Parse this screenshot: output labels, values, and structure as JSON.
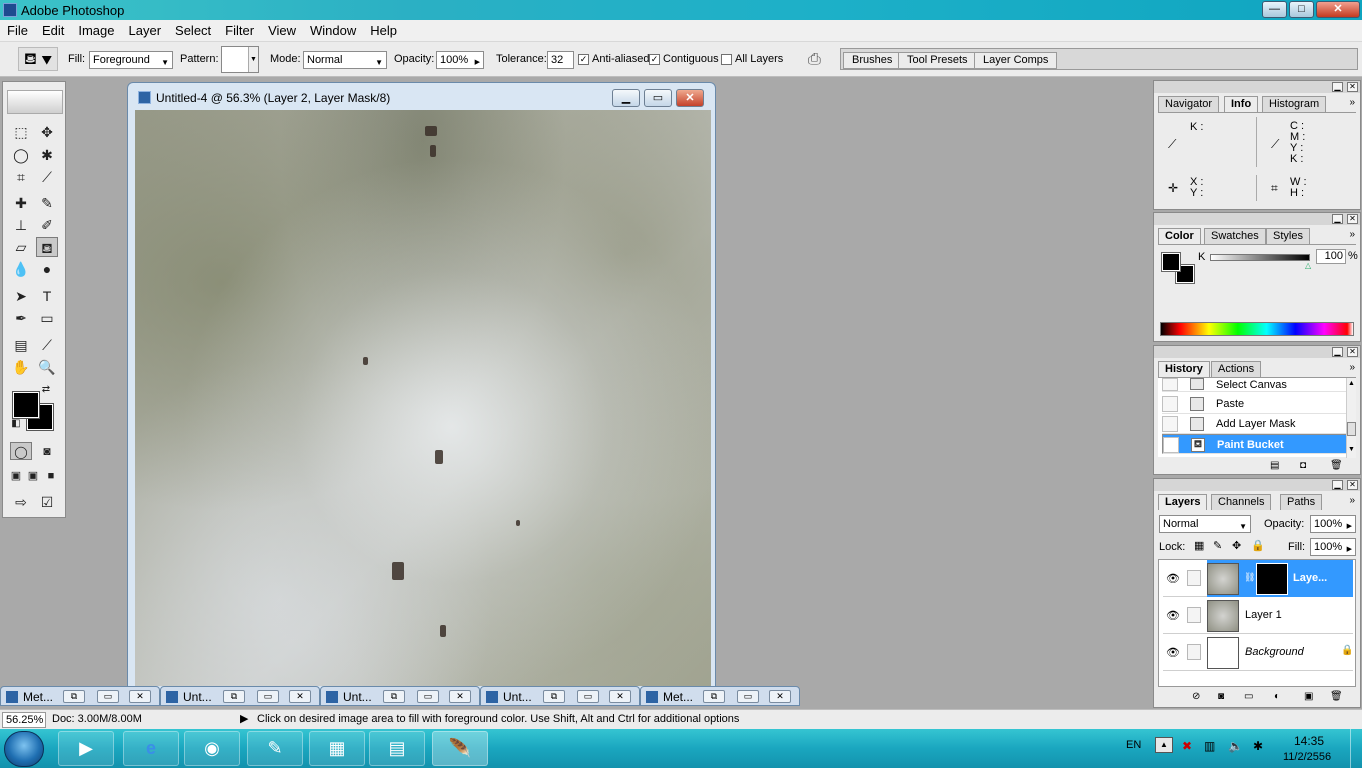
{
  "window": {
    "title": "Adobe Photoshop",
    "min_label": "—",
    "max_label": "□",
    "close_label": "✕"
  },
  "menu": [
    "File",
    "Edit",
    "Image",
    "Layer",
    "Select",
    "Filter",
    "View",
    "Window",
    "Help"
  ],
  "options": {
    "fill_label": "Fill:",
    "fill_value": "Foreground",
    "pattern_label": "Pattern:",
    "mode_label": "Mode:",
    "mode_value": "Normal",
    "opacity_label": "Opacity:",
    "opacity_value": "100%",
    "tolerance_label": "Tolerance:",
    "tolerance_value": "32",
    "anti_aliased_label": "Anti-aliased",
    "anti_aliased_checked": true,
    "contiguous_label": "Contiguous",
    "contiguous_checked": true,
    "all_layers_label": "All Layers",
    "all_layers_checked": false,
    "well_tabs": [
      "Brushes",
      "Tool Presets",
      "Layer Comps"
    ]
  },
  "document": {
    "title": "Untitled-4 @ 56.3% (Layer 2, Layer Mask/8)"
  },
  "minimized_docs": [
    "Met...",
    "Unt...",
    "Unt...",
    "Unt...",
    "Met..."
  ],
  "status": {
    "zoom": "56.25%",
    "doc": "Doc: 3.00M/8.00M",
    "hint": "Click on desired image area to fill with foreground color.  Use Shift, Alt and Ctrl for additional options"
  },
  "info_panel": {
    "tabs": [
      "Navigator",
      "Info",
      "Histogram"
    ],
    "k_label": "K :",
    "cmyk_labels": [
      "C :",
      "M :",
      "Y :",
      "K :"
    ],
    "xy_labels": [
      "X :",
      "Y :"
    ],
    "wh_labels": [
      "W :",
      "H :"
    ]
  },
  "color_panel": {
    "tabs": [
      "Color",
      "Swatches",
      "Styles"
    ],
    "channel_label": "K",
    "value": "100",
    "unit": "%"
  },
  "history_panel": {
    "tabs": [
      "History",
      "Actions"
    ],
    "items": [
      "Select Canvas",
      "Paste",
      "Add Layer Mask",
      "Paint Bucket"
    ]
  },
  "layers_panel": {
    "tabs": [
      "Layers",
      "Channels",
      "Paths"
    ],
    "blend_mode": "Normal",
    "opacity_label": "Opacity:",
    "opacity_value": "100%",
    "lock_label": "Lock:",
    "fill_label": "Fill:",
    "fill_value": "100%",
    "layers": [
      "Laye...",
      "Layer 1",
      "Background"
    ]
  },
  "taskbar": {
    "lang": "EN",
    "time": "14:35",
    "date": "11/2/2556"
  },
  "colors": {
    "selection": "#3399ff",
    "taskbar": "#1aa6bf"
  }
}
